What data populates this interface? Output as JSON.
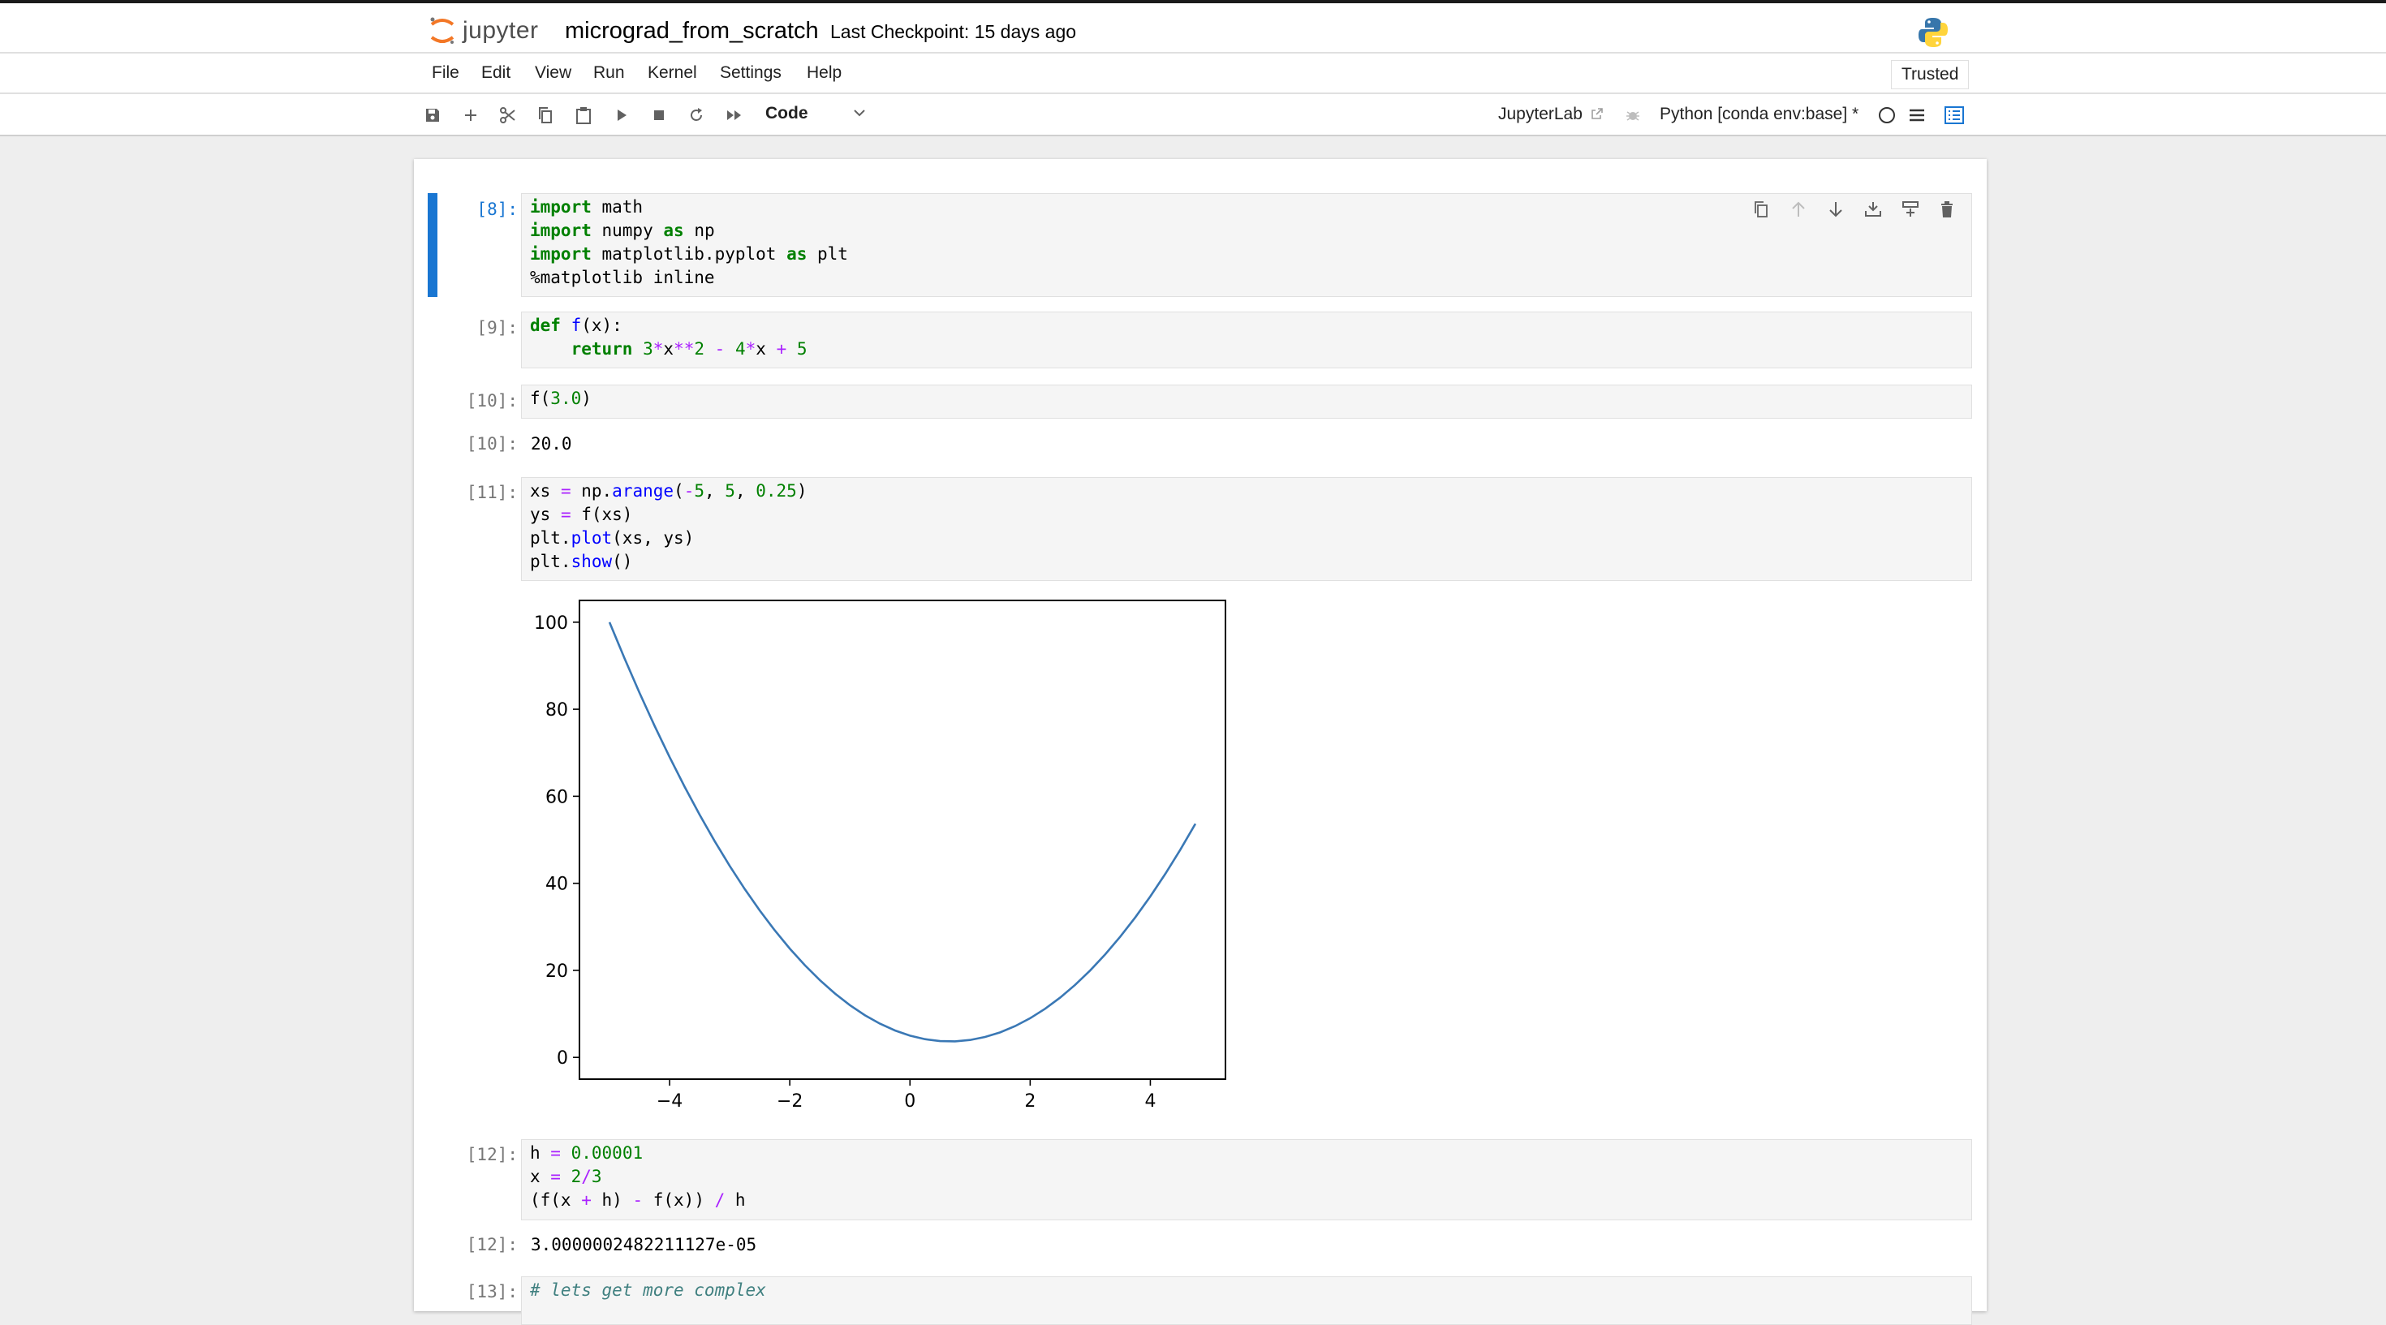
{
  "header": {
    "logo_text": "jupyter",
    "notebook_title": "micrograd_from_scratch",
    "checkpoint": "Last Checkpoint: 15 days ago"
  },
  "menu": [
    "File",
    "Edit",
    "View",
    "Run",
    "Kernel",
    "Settings",
    "Help"
  ],
  "trusted_label": "Trusted",
  "toolbar": {
    "cell_type": "Code",
    "jupyterlab_link": "JupyterLab",
    "kernel": "Python [conda env:base] *"
  },
  "cells": [
    {
      "prompt": "[8]:",
      "lines": [
        "import math",
        "import numpy as np",
        "import matplotlib.pyplot as plt",
        "%matplotlib inline"
      ]
    },
    {
      "prompt": "[9]:",
      "lines": [
        "def f(x):",
        "    return 3*x**2 - 4*x + 5"
      ]
    },
    {
      "prompt": "[10]:",
      "lines": [
        "f(3.0)"
      ],
      "out_prompt": "[10]:",
      "output": "20.0"
    },
    {
      "prompt": "[11]:",
      "lines": [
        "xs = np.arange(-5, 5, 0.25)",
        "ys = f(xs)",
        "plt.plot(xs, ys)",
        "plt.show()"
      ]
    },
    {
      "prompt": "[12]:",
      "lines": [
        "h = 0.00001",
        "x = 2/3",
        "(f(x + h) - f(x)) / h"
      ],
      "out_prompt": "[12]:",
      "output": "3.0000002482211127e-05"
    },
    {
      "prompt": "[13]:",
      "lines": [
        "# lets get more complex"
      ]
    }
  ],
  "chart_data": {
    "type": "line",
    "function": "3*x**2 - 4*x + 5",
    "x_start": -5,
    "x_stop": 5,
    "x_step": 0.25,
    "xlim": [
      -5.5,
      5.25
    ],
    "ylim": [
      -5,
      105
    ],
    "xticks": [
      -4,
      -2,
      0,
      2,
      4
    ],
    "xtick_labels": [
      "−4",
      "−2",
      "0",
      "2",
      "4"
    ],
    "yticks": [
      0,
      20,
      40,
      60,
      80,
      100
    ],
    "ytick_labels": [
      "0",
      "20",
      "40",
      "60",
      "80",
      "100"
    ],
    "line_color": "#3a78b5",
    "grid": false
  }
}
